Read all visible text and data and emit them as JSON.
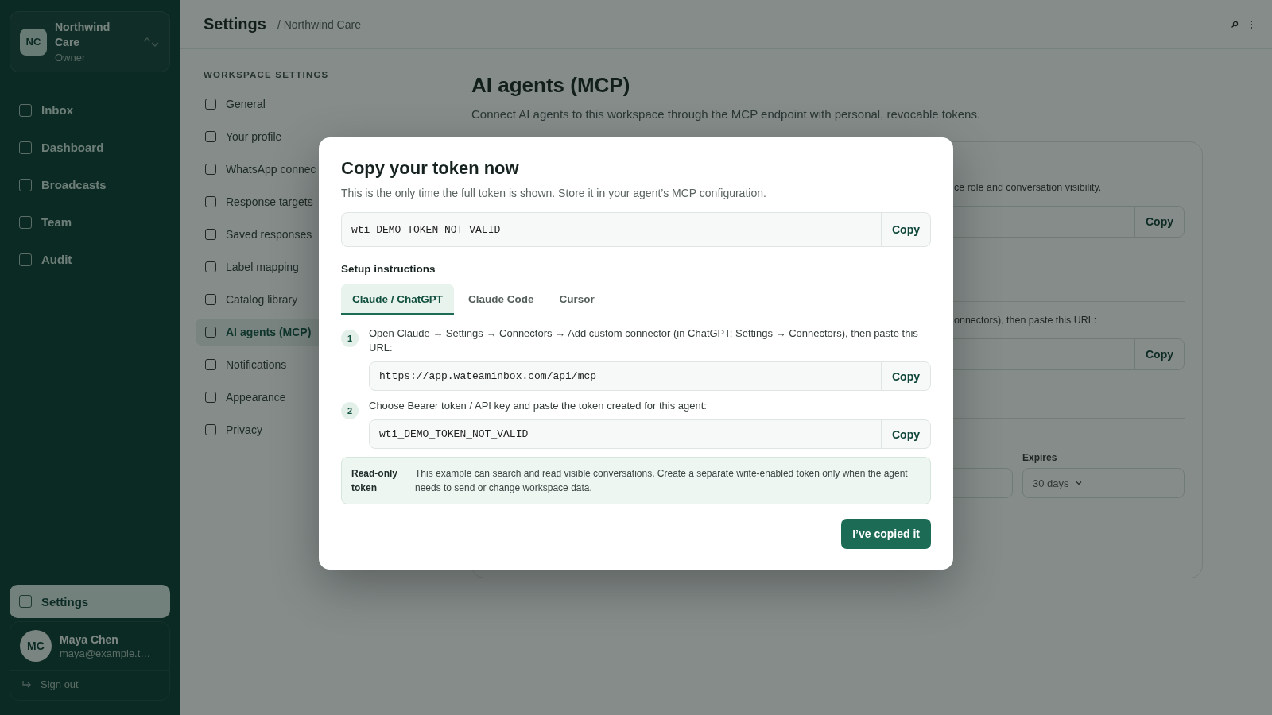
{
  "sidebar": {
    "workspace": {
      "initials": "NC",
      "name": "Northwind Care",
      "role": "Owner"
    },
    "nav": [
      {
        "label": "Inbox",
        "selected": false
      },
      {
        "label": "Dashboard",
        "selected": false
      },
      {
        "label": "Broadcasts",
        "selected": false
      },
      {
        "label": "Team",
        "selected": false
      },
      {
        "label": "Audit",
        "selected": false
      }
    ],
    "settings_item": {
      "label": "Settings",
      "selected": true
    },
    "user": {
      "initials": "MC",
      "name": "Maya Chen",
      "email": "maya@example.t…"
    },
    "sign_out": "Sign out"
  },
  "header": {
    "title": "Settings",
    "breadcrumb": "/ Northwind Care"
  },
  "settings_nav": {
    "heading": "WORKSPACE SETTINGS",
    "items": [
      {
        "label": "General",
        "selected": false
      },
      {
        "label": "Your profile",
        "selected": false
      },
      {
        "label": "WhatsApp connec",
        "selected": false
      },
      {
        "label": "Response targets",
        "selected": false
      },
      {
        "label": "Saved responses",
        "selected": false
      },
      {
        "label": "Label mapping",
        "selected": false
      },
      {
        "label": "Catalog library",
        "selected": false
      },
      {
        "label": "AI agents (MCP)",
        "selected": true
      },
      {
        "label": "Notifications",
        "selected": false
      },
      {
        "label": "Appearance",
        "selected": false
      },
      {
        "label": "Privacy",
        "selected": false
      }
    ]
  },
  "page": {
    "title": "AI agents (MCP)",
    "description": "Connect AI agents to this workspace through the MCP endpoint with personal, revocable tokens.",
    "card": {
      "text_1": "ce role and conversation visibility.",
      "copy_1": "Copy",
      "text_2": "onnectors), then paste this URL:",
      "copy_2": "Copy",
      "expires_label": "Expires",
      "expires_value": "30 days"
    }
  },
  "modal": {
    "title": "Copy your token now",
    "description": "This is the only time the full token is shown. Store it in your agent’s MCP configuration.",
    "token": "wti_DEMO_TOKEN_NOT_VALID",
    "copy": "Copy",
    "setup_heading": "Setup instructions",
    "tabs": [
      {
        "label": "Claude / ChatGPT",
        "selected": true
      },
      {
        "label": "Claude Code",
        "selected": false
      },
      {
        "label": "Cursor",
        "selected": false
      }
    ],
    "steps": [
      {
        "number": "1",
        "text": "Open Claude → Settings → Connectors → Add custom connector (in ChatGPT: Settings → Connectors), then paste this URL:",
        "value": "https://app.wateaminbox.com/api/mcp",
        "copy": "Copy"
      },
      {
        "number": "2",
        "text": "Choose Bearer token / API key and paste the token created for this agent:",
        "value": "wti_DEMO_TOKEN_NOT_VALID",
        "copy": "Copy"
      }
    ],
    "note": {
      "label": "Read-only token",
      "text": "This example can search and read visible conversations. Create a separate write-enabled token only when the agent needs to send or change workspace data."
    },
    "confirm": "I’ve copied it"
  }
}
